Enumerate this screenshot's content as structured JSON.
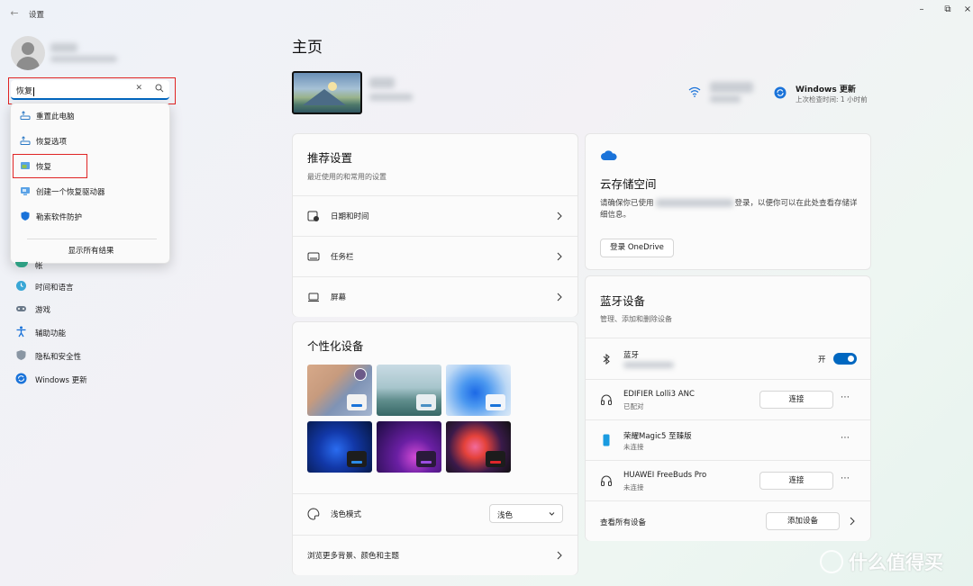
{
  "app": {
    "title": "设置",
    "back_icon": "back-arrow-icon"
  },
  "window_controls": [
    "minimize-icon",
    "restore-icon",
    "close-icon"
  ],
  "search": {
    "value": "恢复",
    "clear_icon": "clear-icon",
    "search_icon": "search-icon"
  },
  "search_results": [
    {
      "label": "重置此电脑",
      "icon": "reset-pc-icon"
    },
    {
      "label": "恢复选项",
      "icon": "recovery-options-icon"
    },
    {
      "label": "恢复",
      "icon": "recovery-icon",
      "highlighted": true
    },
    {
      "label": "创建一个恢复驱动器",
      "icon": "recovery-drive-icon"
    },
    {
      "label": "勒索软件防护",
      "icon": "shield-icon"
    }
  ],
  "show_all_results": "显示所有结果",
  "nav": {
    "partial_label": "帐",
    "items": [
      {
        "label": "时间和语言",
        "icon": "time-language-icon"
      },
      {
        "label": "游戏",
        "icon": "gaming-icon"
      },
      {
        "label": "辅助功能",
        "icon": "accessibility-icon"
      },
      {
        "label": "隐私和安全性",
        "icon": "privacy-shield-icon"
      },
      {
        "label": "Windows 更新",
        "icon": "windows-update-icon"
      }
    ]
  },
  "main": {
    "title": "主页",
    "update": {
      "title": "Windows 更新",
      "subtitle": "上次检查时间: 1 小时前"
    },
    "recommended": {
      "title": "推荐设置",
      "subtitle": "最近使用的和常用的设置",
      "rows": [
        {
          "label": "日期和时间",
          "icon": "date-time-icon"
        },
        {
          "label": "任务栏",
          "icon": "taskbar-icon"
        },
        {
          "label": "屏幕",
          "icon": "display-icon"
        }
      ]
    },
    "personalize": {
      "title": "个性化设备",
      "color_mode_label": "浅色模式",
      "color_mode_value": "浅色",
      "browse_more": "浏览更多背景、颜色和主题"
    },
    "cloud": {
      "title": "云存储空间",
      "desc_prefix": "请确保你已使用",
      "desc_suffix": "登录，以便你可以在此处查看存储详细信息。",
      "button": "登录 OneDrive"
    },
    "bluetooth": {
      "title": "蓝牙设备",
      "subtitle": "管理、添加和删除设备",
      "bt_label": "蓝牙",
      "bt_state": "开",
      "devices": [
        {
          "name": "EDIFIER Lolli3 ANC",
          "status": "已配对",
          "action": "连接",
          "icon": "headphones-icon"
        },
        {
          "name": "荣耀Magic5 至臻版",
          "status": "未连接",
          "action": "",
          "icon": "phone-icon"
        },
        {
          "name": "HUAWEI FreeBuds Pro",
          "status": "未连接",
          "action": "连接",
          "icon": "headphones-icon"
        }
      ],
      "view_all": "查看所有设备",
      "add_device": "添加设备"
    }
  },
  "watermark": "什么值得买",
  "colors": {
    "accent": "#0067c0",
    "highlight_border": "#e02424"
  }
}
